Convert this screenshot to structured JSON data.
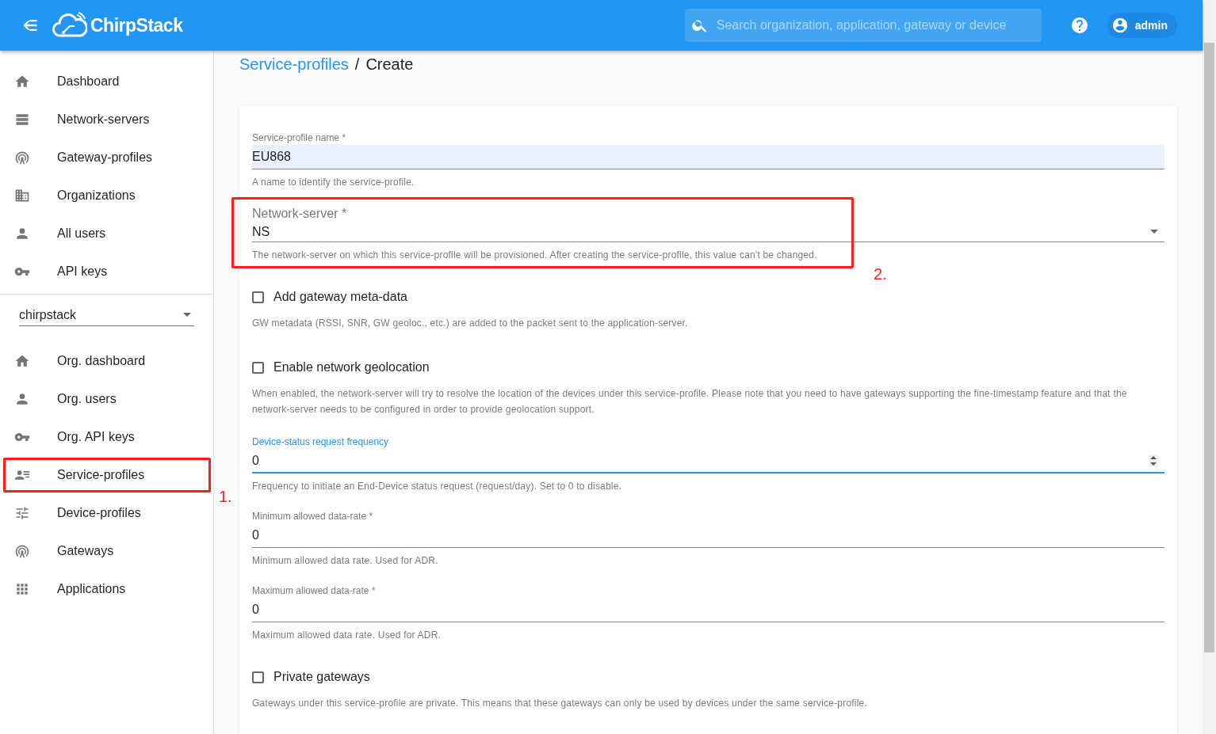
{
  "header": {
    "logo_text": "ChirpStack",
    "search": {
      "placeholder": "Search organization, application, gateway or device"
    },
    "user": "admin"
  },
  "sidebar": {
    "items": [
      {
        "label": "Dashboard",
        "selected": false
      },
      {
        "label": "Network-servers",
        "selected": false
      },
      {
        "label": "Gateway-profiles",
        "selected": false
      },
      {
        "label": "Organizations",
        "selected": false
      },
      {
        "label": "All users",
        "selected": false
      },
      {
        "label": "API keys",
        "selected": false
      }
    ],
    "organization_select": {
      "value": "chirpstack"
    },
    "org_items": [
      {
        "label": "Org. dashboard",
        "selected": false
      },
      {
        "label": "Org. users",
        "selected": false
      },
      {
        "label": "Org. API keys",
        "selected": false
      },
      {
        "label": "Service-profiles",
        "selected": false
      },
      {
        "label": "Device-profiles",
        "selected": false
      },
      {
        "label": "Gateways",
        "selected": false
      },
      {
        "label": "Applications",
        "selected": false
      }
    ]
  },
  "breadcrumb": {
    "link": "Service-profiles",
    "separator": "/",
    "current": "Create"
  },
  "form": {
    "fields": [
      {
        "kind": "text",
        "label": "Service-profile name *",
        "value": "EU868",
        "helper": "A name to identify the service-profile."
      },
      {
        "kind": "select",
        "label": "Network-server *",
        "value": "NS",
        "helper": "The network-server on which this service-profile will be provisioned. After creating the service-profile, this value can't be changed."
      },
      {
        "kind": "checkbox",
        "label": "Add gateway meta-data",
        "checked": false,
        "helper": "GW metadata (RSSI, SNR, GW geoloc., etc.) are added to the packet sent to the application-server."
      },
      {
        "kind": "checkbox",
        "label": "Enable network geolocation",
        "checked": false,
        "helper": "When enabled, the network-server will try to resolve the location of the devices under this service-profile. Please note that you need to have gateways supporting the fine-timestamp feature and that the network-server needs to be configured in order to provide geolocation support."
      },
      {
        "kind": "number",
        "label": "Device-status request frequency",
        "value": "0",
        "helper": "Frequency to initiate an End-Device status request (request/day). Set to 0 to disable.",
        "focused": true
      },
      {
        "kind": "text",
        "label": "Minimum allowed data-rate *",
        "value": "0",
        "helper": "Minimum allowed data rate. Used for ADR."
      },
      {
        "kind": "text",
        "label": "Maximum allowed data-rate *",
        "value": "0",
        "helper": "Maximum allowed data rate. Used for ADR."
      },
      {
        "kind": "checkbox",
        "label": "Private gateways",
        "checked": false,
        "helper": "Gateways under this service-profile are private. This means that these gateways can only be used by devices under the same service-profile."
      }
    ]
  },
  "annotations": [
    {
      "label": "1."
    },
    {
      "label": "2."
    }
  ]
}
